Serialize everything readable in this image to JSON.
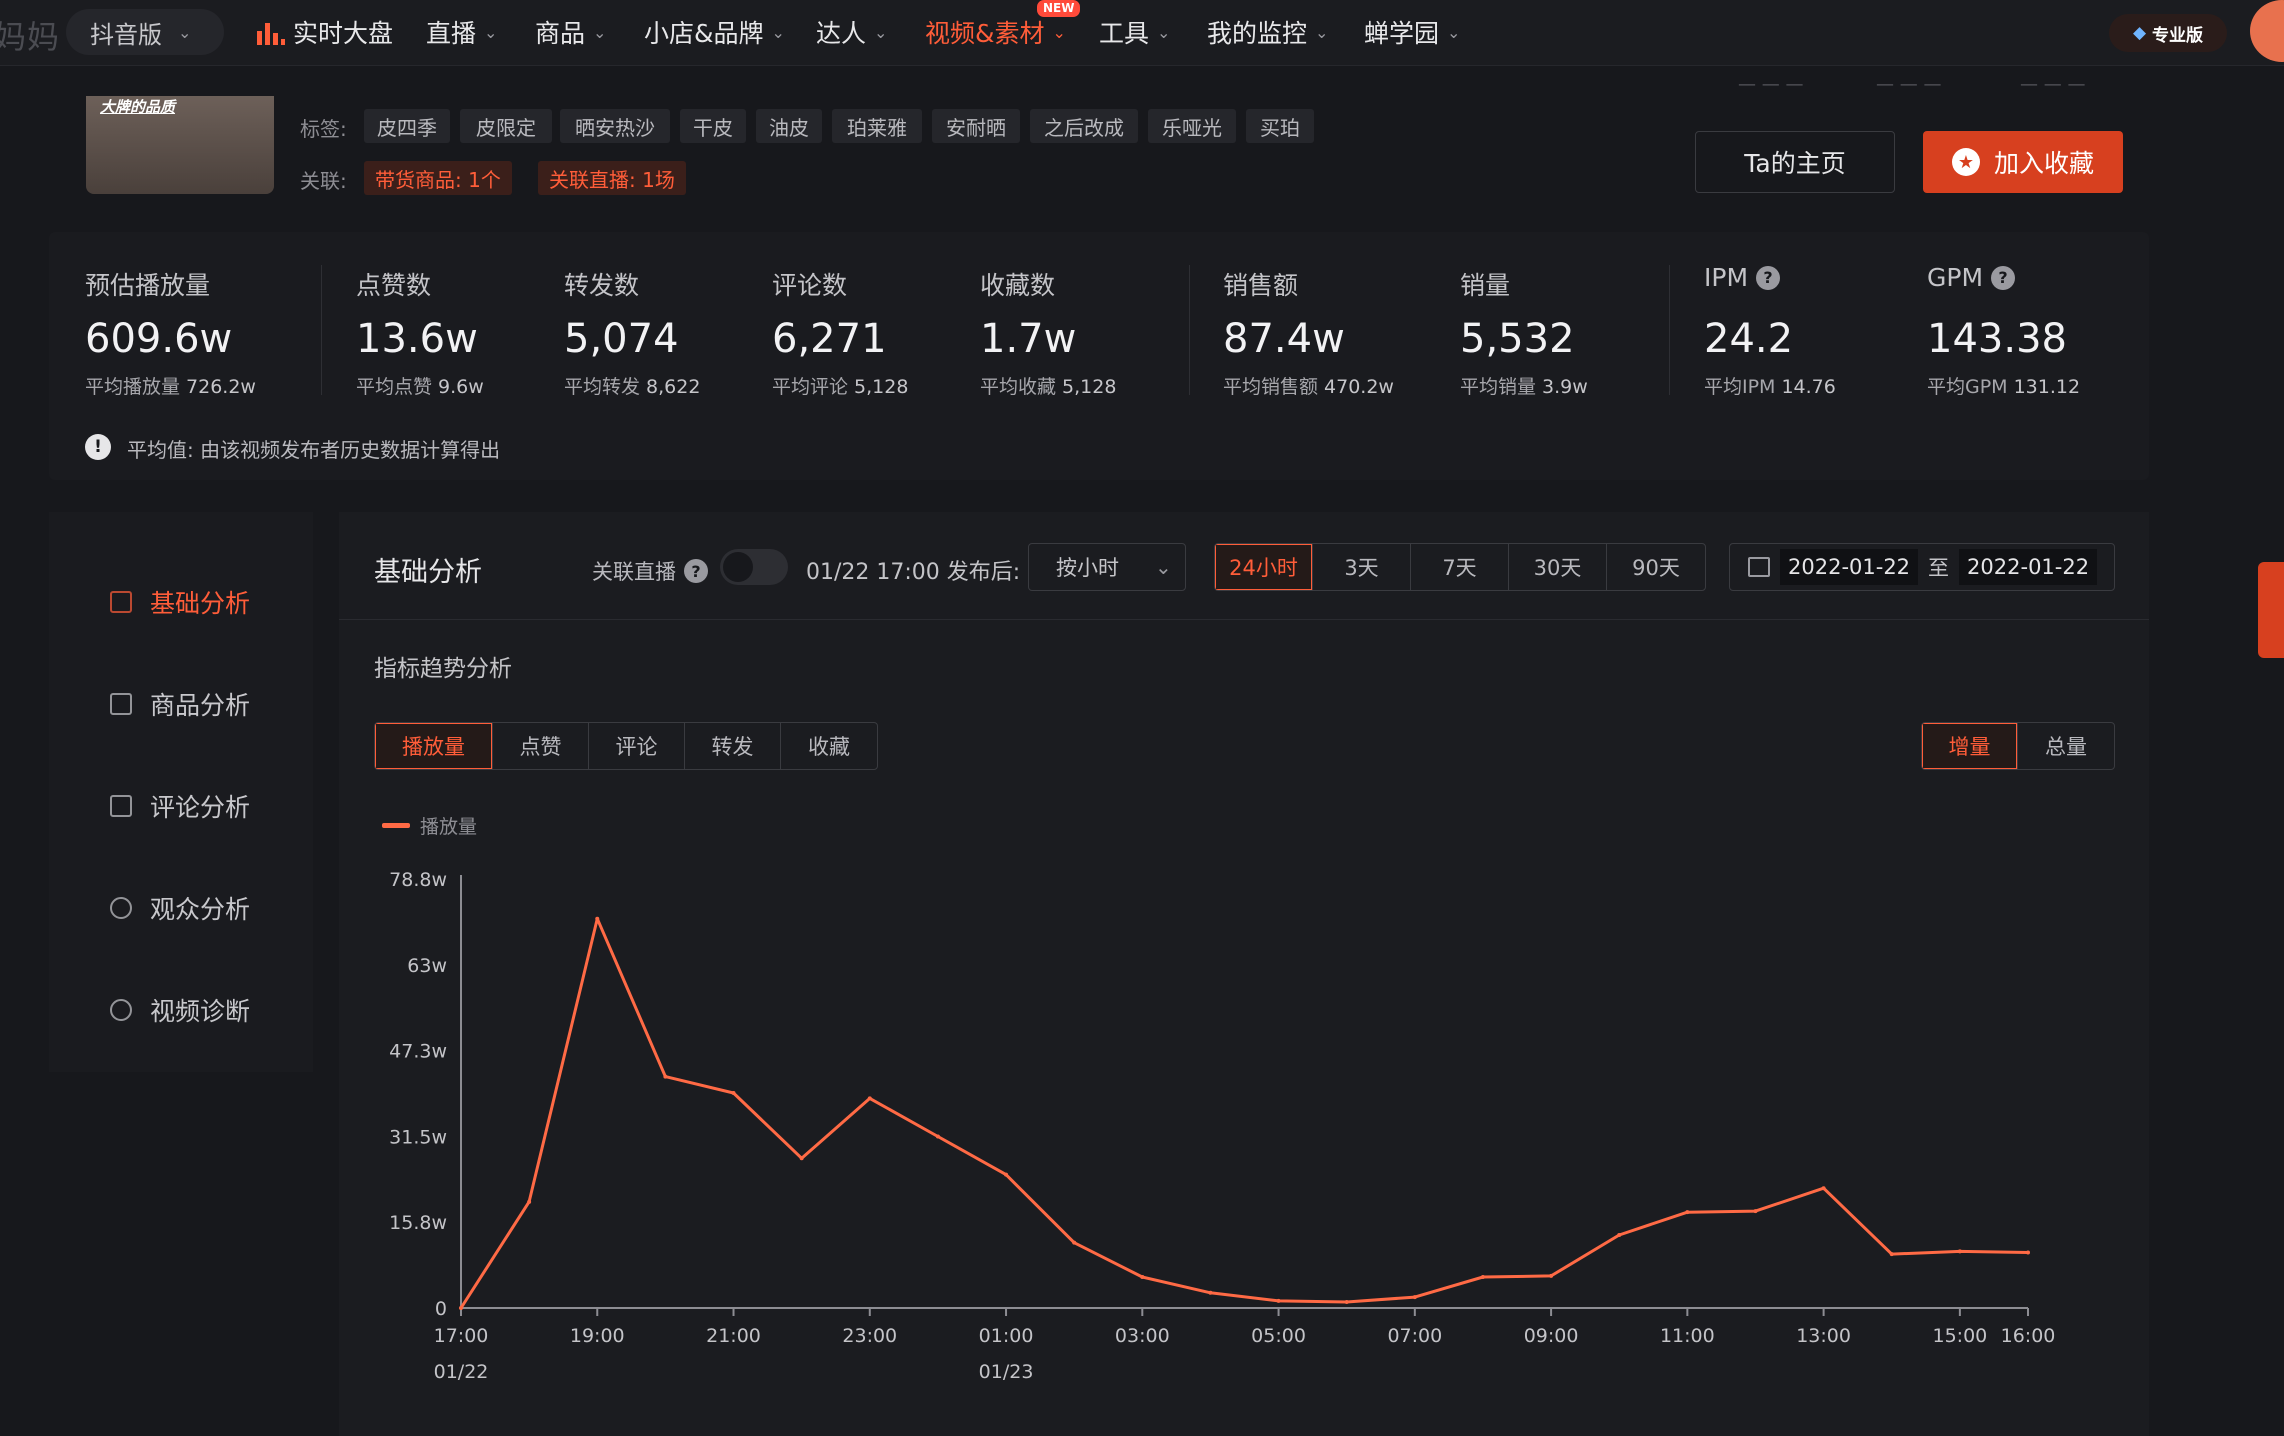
{
  "nav": {
    "logo_fragment": "妈妈",
    "platform": "抖音版",
    "items": [
      {
        "label": "实时大盘",
        "has_icon": true,
        "dropdown": false,
        "active": false
      },
      {
        "label": "直播",
        "dropdown": true,
        "active": false
      },
      {
        "label": "商品",
        "dropdown": true,
        "active": false
      },
      {
        "label": "小店&品牌",
        "dropdown": true,
        "active": false
      },
      {
        "label": "达人",
        "dropdown": true,
        "active": false
      },
      {
        "label": "视频&素材",
        "dropdown": true,
        "active": true,
        "badge": "NEW"
      },
      {
        "label": "工具",
        "dropdown": true,
        "active": false
      },
      {
        "label": "我的监控",
        "dropdown": true,
        "active": false
      },
      {
        "label": "蝉学园",
        "dropdown": true,
        "active": false
      }
    ],
    "pro_label": "专业版",
    "accent": "#ff5d39"
  },
  "video": {
    "thumb_caption": "大牌的品质",
    "tags_label": "标签:",
    "tags": [
      "皮四季",
      "皮限定",
      "晒安热沙",
      "干皮",
      "油皮",
      "珀莱雅",
      "安耐晒",
      "之后改成",
      "乐哑光",
      "买珀"
    ],
    "relation_label": "关联:",
    "relations": [
      "带货商品: 1个",
      "关联直播: 1场"
    ],
    "ta_home": "Ta的主页",
    "add_fav": "加入收藏"
  },
  "metrics": [
    {
      "label": "预估播放量",
      "value": "609.6w",
      "avg_label": "平均播放量",
      "avg": "726.2w"
    },
    {
      "label": "点赞数",
      "value": "13.6w",
      "avg_label": "平均点赞",
      "avg": "9.6w"
    },
    {
      "label": "转发数",
      "value": "5,074",
      "avg_label": "平均转发",
      "avg": "8,622"
    },
    {
      "label": "评论数",
      "value": "6,271",
      "avg_label": "平均评论",
      "avg": "5,128"
    },
    {
      "label": "收藏数",
      "value": "1.7w",
      "avg_label": "平均收藏",
      "avg": "5,128"
    },
    {
      "label": "销售额",
      "value": "87.4w",
      "avg_label": "平均销售额",
      "avg": "470.2w"
    },
    {
      "label": "销量",
      "value": "5,532",
      "avg_label": "平均销量",
      "avg": "3.9w"
    },
    {
      "label": "IPM",
      "value": "24.2",
      "avg_label": "平均IPM",
      "avg": "14.76",
      "help": true
    },
    {
      "label": "GPM",
      "value": "143.38",
      "avg_label": "平均GPM",
      "avg": "131.12",
      "help": true
    }
  ],
  "metrics_note": "平均值: 由该视频发布者历史数据计算得出",
  "sidebar": {
    "items": [
      {
        "label": "基础分析",
        "active": true,
        "icon": "bar-chart-icon"
      },
      {
        "label": "商品分析",
        "active": false,
        "icon": "bag-icon"
      },
      {
        "label": "评论分析",
        "active": false,
        "icon": "comment-icon"
      },
      {
        "label": "观众分析",
        "active": false,
        "icon": "user-icon"
      },
      {
        "label": "视频诊断",
        "active": false,
        "icon": "play-icon"
      }
    ]
  },
  "analysis": {
    "title": "基础分析",
    "live_label": "关联直播",
    "publish_text": "01/22 17:00 发布后:",
    "granularity": "按小时",
    "ranges": [
      "24小时",
      "3天",
      "7天",
      "30天",
      "90天"
    ],
    "active_range": "24小时",
    "date_from": "2022-01-22",
    "date_sep": "至",
    "date_to": "2022-01-22",
    "trend_title": "指标趋势分析",
    "metric_tabs": [
      "播放量",
      "点赞",
      "评论",
      "转发",
      "收藏"
    ],
    "active_metric": "播放量",
    "mode_tabs": [
      "增量",
      "总量"
    ],
    "active_mode": "增量"
  },
  "chart_data": {
    "type": "line",
    "title": "",
    "series": [
      {
        "name": "播放量",
        "color": "#ff6a45",
        "values": [
          0,
          19.5,
          71.5,
          42.5,
          39.5,
          27.5,
          38.5,
          31.5,
          24.5,
          12,
          5.7,
          2.8,
          1.3,
          1.1,
          2,
          5.7,
          5.9,
          13.4,
          17.6,
          17.8,
          22,
          9.9,
          10.4,
          10.2
        ]
      }
    ],
    "x": [
      "17:00",
      "18:00",
      "19:00",
      "20:00",
      "21:00",
      "22:00",
      "23:00",
      "00:00",
      "01:00",
      "02:00",
      "03:00",
      "04:00",
      "05:00",
      "06:00",
      "07:00",
      "08:00",
      "09:00",
      "10:00",
      "11:00",
      "12:00",
      "13:00",
      "14:00",
      "15:00",
      "16:00"
    ],
    "x_tick_labels": [
      "17:00",
      "19:00",
      "21:00",
      "23:00",
      "01:00",
      "03:00",
      "05:00",
      "07:00",
      "09:00",
      "11:00",
      "13:00",
      "15:00",
      "16:00"
    ],
    "x_date_labels": [
      {
        "at": "17:00",
        "text": "01/22"
      },
      {
        "at": "01:00",
        "text": "01/23"
      }
    ],
    "y_ticks": [
      0,
      15.8,
      31.5,
      47.3,
      63,
      78.8
    ],
    "y_tick_labels": [
      "0",
      "15.8w",
      "31.5w",
      "47.3w",
      "63w",
      "78.8w"
    ],
    "ylim": [
      0,
      78.8
    ],
    "unit": "w",
    "legend": "top-left",
    "grid": false
  }
}
